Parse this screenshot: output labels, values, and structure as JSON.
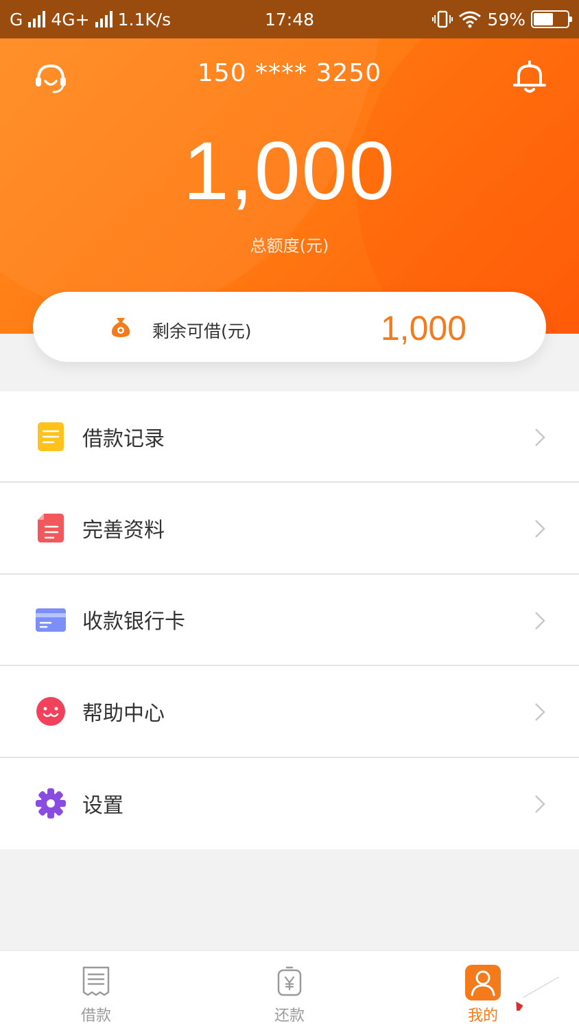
{
  "status_bar": {
    "carrier1": "G",
    "carrier2": "4G+",
    "speed": "1.1K/s",
    "time": "17:48",
    "battery": "59%",
    "battery_level": 0.59
  },
  "header": {
    "phone": "150 **** 3250",
    "total_amount": "1,000",
    "total_label": "总额度(元)",
    "support_icon": "headset-icon",
    "notify_icon": "bell-icon"
  },
  "remaining": {
    "label": "剩余可借(元)",
    "value": "1,000",
    "icon": "money-bag-icon"
  },
  "menu": {
    "items": [
      {
        "label": "借款记录",
        "icon": "note-icon",
        "color": "#ffc21a"
      },
      {
        "label": "完善资料",
        "icon": "document-icon",
        "color": "#f2575b"
      },
      {
        "label": "收款银行卡",
        "icon": "bank-card-icon",
        "color": "#7c8ff7"
      },
      {
        "label": "帮助中心",
        "icon": "smile-icon",
        "color": "#f2415a"
      },
      {
        "label": "设置",
        "icon": "gear-icon",
        "color": "#8a4be0"
      }
    ]
  },
  "tabbar": {
    "tabs": [
      {
        "label": "借款",
        "icon": "receipt-icon"
      },
      {
        "label": "还款",
        "icon": "yen-icon"
      },
      {
        "label": "我的",
        "icon": "user-icon",
        "active": true
      }
    ]
  },
  "colors": {
    "accent": "#f47a1c",
    "header_gradient_start": "#ff8a1f",
    "header_gradient_end": "#ff5e0a",
    "status_bar": "#9a4c0f"
  }
}
